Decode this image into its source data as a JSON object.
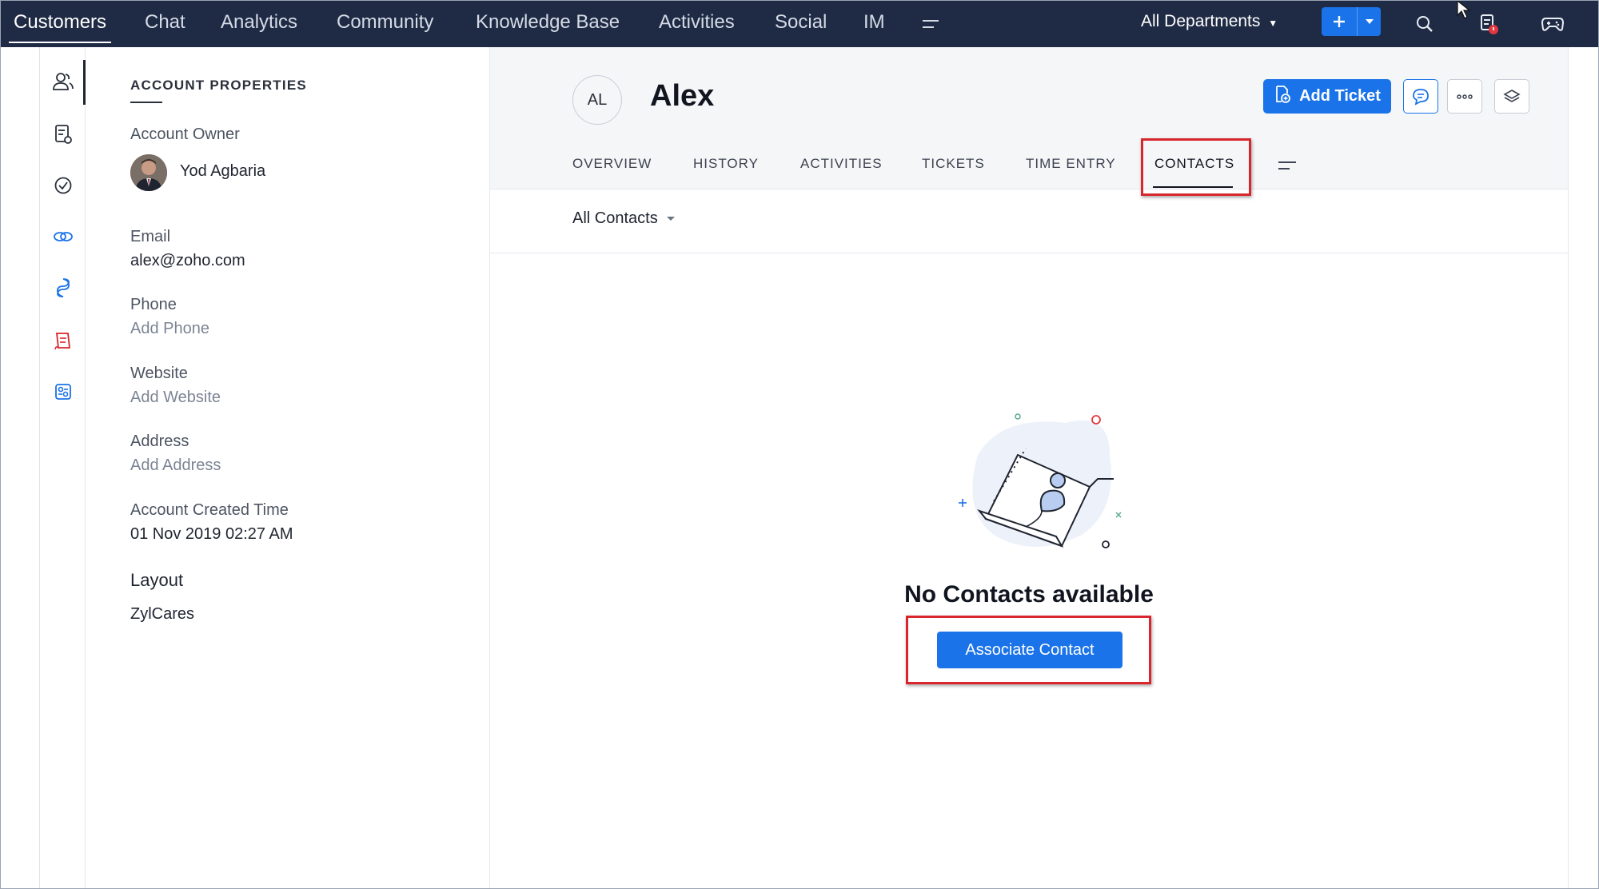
{
  "topnav": {
    "items": [
      {
        "label": "Customers",
        "active": true
      },
      {
        "label": "Chat"
      },
      {
        "label": "Analytics"
      },
      {
        "label": "Community"
      },
      {
        "label": "Knowledge Base"
      },
      {
        "label": "Activities"
      },
      {
        "label": "Social"
      },
      {
        "label": "IM"
      }
    ],
    "more_icon": "menu-lines-icon",
    "department": "All Departments",
    "add_icon": "plus-icon",
    "add_dropdown_icon": "caret-down-icon",
    "search_icon": "search-icon",
    "notification_icon": "notification-icon",
    "apps_icon": "gamepad-icon"
  },
  "rail": {
    "icons": [
      "customers-icon",
      "tickets-icon",
      "tasks-icon",
      "links-icon",
      "integrations-icon",
      "reports-icon",
      "dashboard-icon"
    ]
  },
  "props": {
    "title": "ACCOUNT PROPERTIES",
    "owner_label": "Account Owner",
    "owner_name": "Yod Agbaria",
    "email_label": "Email",
    "email_value": "alex@zoho.com",
    "phone_label": "Phone",
    "phone_value": "Add Phone",
    "website_label": "Website",
    "website_value": "Add Website",
    "address_label": "Address",
    "address_value": "Add Address",
    "created_label": "Account Created Time",
    "created_value": "01 Nov 2019 02:27 AM",
    "layout_label": "Layout",
    "layout_value": "ZylCares"
  },
  "header": {
    "avatar_initials": "AL",
    "account_name": "Alex",
    "add_ticket_label": "Add Ticket",
    "chat_icon": "chat-bubble-icon",
    "more_icon": "ellipsis-icon",
    "layers_icon": "layers-icon"
  },
  "tabs": [
    {
      "label": "OVERVIEW"
    },
    {
      "label": "HISTORY"
    },
    {
      "label": "ACTIVITIES"
    },
    {
      "label": "TICKETS"
    },
    {
      "label": "TIME ENTRY"
    },
    {
      "label": "CONTACTS",
      "active": true
    }
  ],
  "filter": {
    "label": "All Contacts"
  },
  "empty": {
    "title": "No Contacts available",
    "button": "Associate Contact"
  },
  "colors": {
    "nav_bg": "#1f2a44",
    "accent": "#1a73e8",
    "highlight": "#d9262c"
  }
}
